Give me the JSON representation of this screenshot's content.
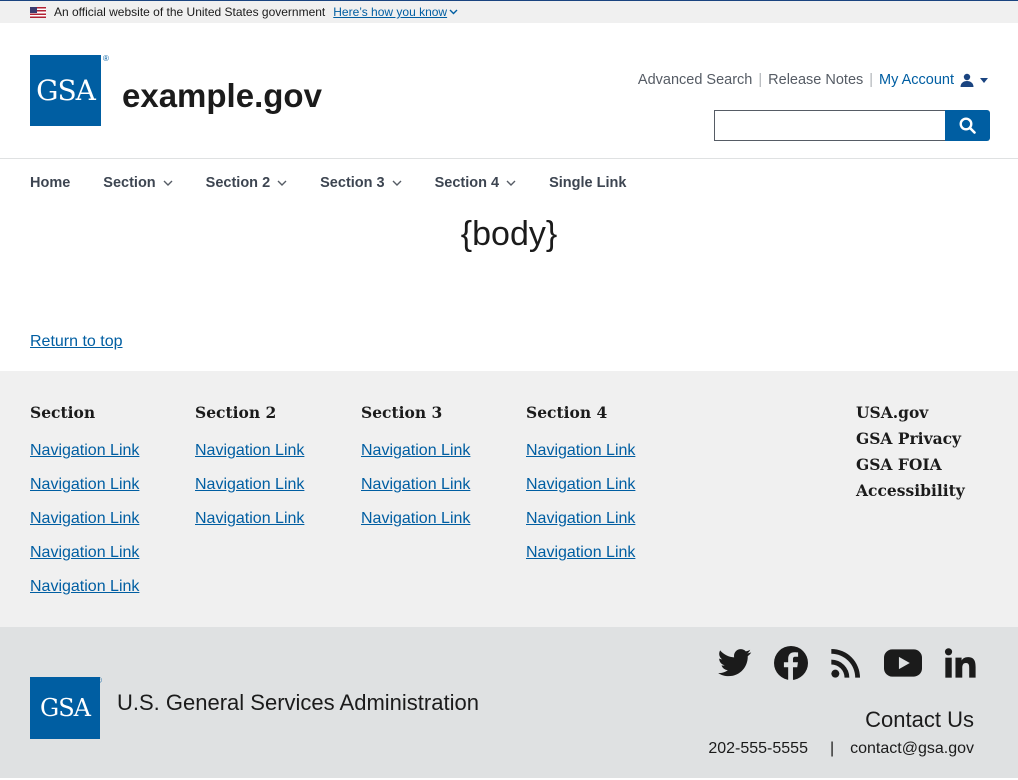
{
  "banner": {
    "text": "An official website of the United States government",
    "link": "Here’s how you know"
  },
  "header": {
    "logo_text": "GSA",
    "logo_reg": "®",
    "site_title": "example.gov",
    "secondary_links": [
      "Advanced Search",
      "Release Notes",
      "My Account"
    ],
    "search_placeholder": ""
  },
  "nav": {
    "items": [
      "Home",
      "Section",
      "Section 2",
      "Section 3",
      "Section 4",
      "Single Link"
    ]
  },
  "main": {
    "body_placeholder": "{body}",
    "return_to_top": "Return to top"
  },
  "footer": {
    "columns": [
      {
        "title": "Section",
        "links": [
          "Navigation Link",
          "Navigation Link",
          "Navigation Link",
          "Navigation Link",
          "Navigation Link"
        ]
      },
      {
        "title": "Section 2",
        "links": [
          "Navigation Link",
          "Navigation Link",
          "Navigation Link"
        ]
      },
      {
        "title": "Section 3",
        "links": [
          "Navigation Link",
          "Navigation Link",
          "Navigation Link"
        ]
      },
      {
        "title": "Section 4",
        "links": [
          "Navigation Link",
          "Navigation Link",
          "Navigation Link",
          "Navigation Link"
        ]
      }
    ],
    "right_links": [
      "USA.gov",
      "GSA Privacy",
      "GSA FOIA",
      "Accessibility"
    ],
    "agency_logo_text": "GSA",
    "agency_reg": "®",
    "agency_name": "U.S. General Services Administration",
    "social_icons": [
      "twitter-icon",
      "facebook-icon",
      "rss-icon",
      "youtube-icon",
      "linkedin-icon"
    ],
    "contact_title": "Contact Us",
    "phone": "202-555-5555",
    "separator": "|",
    "email": "contact@gsa.gov"
  },
  "colors": {
    "primary": "#005ea2",
    "text": "#1b1b1b",
    "footer_primary_bg": "#f0f0f0",
    "footer_secondary_bg": "#dfe1e2"
  }
}
